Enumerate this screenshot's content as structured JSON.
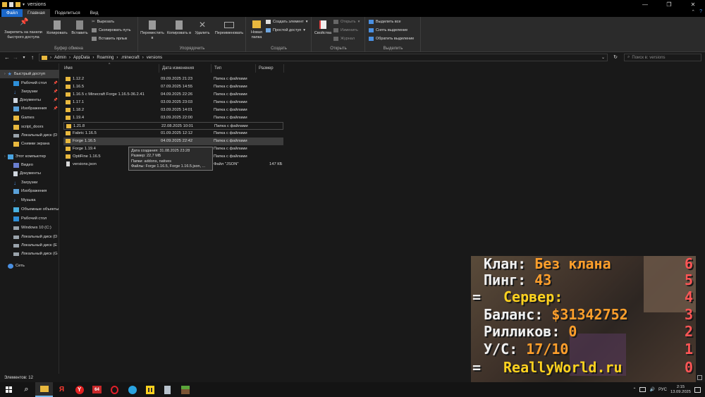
{
  "window": {
    "title": "versions"
  },
  "tabs": {
    "file": "Файл",
    "home": "Главная",
    "share": "Поделиться",
    "view": "Вид"
  },
  "ribbon": {
    "pin_label": "Закрепить на панели быстрого доступа",
    "copy_label": "Копировать",
    "paste_label": "Вставить",
    "cut_label": "Вырезать",
    "copy_path_label": "Скопировать путь",
    "paste_shortcut_label": "Вставить ярлык",
    "clipboard_group": "Буфер обмена",
    "move_label": "Переместить в",
    "copy_to_label": "Копировать в",
    "delete_label": "Удалить",
    "rename_label": "Переименовать",
    "organize_group": "Упорядочить",
    "new_folder_label": "Новая папка",
    "new_item_label": "Создать элемент",
    "easy_access_label": "Простой доступ",
    "new_group": "Создать",
    "properties_label": "Свойства",
    "open_label": "Открыть",
    "edit_label": "Изменить",
    "history_label": "Журнал",
    "open_group": "Открыть",
    "select_all_label": "Выделить все",
    "select_none_label": "Снять выделение",
    "invert_selection_label": "Обратить выделение",
    "select_group": "Выделить"
  },
  "address": {
    "path": [
      "Admin",
      "AppData",
      "Roaming",
      ".minecraft",
      "versions"
    ],
    "search_placeholder": "Поиск в: versions"
  },
  "nav": {
    "items": [
      {
        "label": "Быстрый доступ",
        "icon": "star-icon",
        "pinned": false
      },
      {
        "label": "Рабочий стол",
        "icon": "desktop-icon",
        "pinned": true
      },
      {
        "label": "Загрузки",
        "icon": "download-icon",
        "pinned": true
      },
      {
        "label": "Документы",
        "icon": "documents-icon",
        "pinned": true
      },
      {
        "label": "Изображения",
        "icon": "pictures-icon",
        "pinned": true
      },
      {
        "label": "Games",
        "icon": "folder-icon",
        "pinned": false
      },
      {
        "label": "script_doors",
        "icon": "folder-icon",
        "pinned": false
      },
      {
        "label": "Локальный диск (D",
        "icon": "drive-icon",
        "pinned": false
      },
      {
        "label": "Снимки экрана",
        "icon": "folder-icon",
        "pinned": false
      },
      {
        "label": "Этот компьютер",
        "icon": "computer-icon",
        "pinned": false
      },
      {
        "label": "Видео",
        "icon": "video-icon",
        "pinned": false
      },
      {
        "label": "Документы",
        "icon": "documents-icon",
        "pinned": false
      },
      {
        "label": "Загрузки",
        "icon": "download-icon",
        "pinned": false
      },
      {
        "label": "Изображения",
        "icon": "pictures-icon",
        "pinned": false
      },
      {
        "label": "Музыка",
        "icon": "music-icon",
        "pinned": false
      },
      {
        "label": "Объемные объекты",
        "icon": "3d-objects-icon",
        "pinned": false
      },
      {
        "label": "Рабочий стол",
        "icon": "desktop-icon",
        "pinned": false
      },
      {
        "label": "Windows 10 (C:)",
        "icon": "drive-icon",
        "pinned": false
      },
      {
        "label": "Локальный диск (D",
        "icon": "drive-icon",
        "pinned": false
      },
      {
        "label": "Локальный диск (E",
        "icon": "drive-icon",
        "pinned": false
      },
      {
        "label": "Локальный диск (G",
        "icon": "drive-icon",
        "pinned": false
      },
      {
        "label": "Сеть",
        "icon": "network-icon",
        "pinned": false
      }
    ]
  },
  "columns": {
    "name": "Имя",
    "date": "Дата изменения",
    "type": "Тип",
    "size": "Размер"
  },
  "files": [
    {
      "name": "1.12.2",
      "date": "09.09.2025 21:23",
      "type": "Папка с файлами",
      "size": "",
      "kind": "folder"
    },
    {
      "name": "1.16.5",
      "date": "07.09.2025 14:55",
      "type": "Папка с файлами",
      "size": "",
      "kind": "folder"
    },
    {
      "name": "1.16.5 с Minecraft Forge 1.16.5-36.2.41",
      "date": "04.09.2025 22:26",
      "type": "Папка с файлами",
      "size": "",
      "kind": "folder"
    },
    {
      "name": "1.17.1",
      "date": "03.09.2025 23:03",
      "type": "Папка с файлами",
      "size": "",
      "kind": "folder"
    },
    {
      "name": "1.18.2",
      "date": "03.09.2025 14:01",
      "type": "Папка с файлами",
      "size": "",
      "kind": "folder"
    },
    {
      "name": "1.19.4",
      "date": "03.09.2025 22:00",
      "type": "Папка с файлами",
      "size": "",
      "kind": "folder"
    },
    {
      "name": "1.21.8",
      "date": "22.08.2025 10:01",
      "type": "Папка с файлами",
      "size": "",
      "kind": "folder"
    },
    {
      "name": "Fabric 1.16.5",
      "date": "01.09.2025 12:12",
      "type": "Папка с файлами",
      "size": "",
      "kind": "folder"
    },
    {
      "name": "Forge 1.16.5",
      "date": "04.09.2025 22:42",
      "type": "Папка с файлами",
      "size": "",
      "kind": "folder"
    },
    {
      "name": "Forge 1.19.4",
      "date": "",
      "type": "Папка с файлами",
      "size": "",
      "kind": "folder"
    },
    {
      "name": "OptiFine 1.16.5",
      "date": "",
      "type": "Папка с файлами",
      "size": "",
      "kind": "folder"
    },
    {
      "name": "versions.json",
      "date": "",
      "type": "Файл \"JSON\"",
      "size": "147 КБ",
      "kind": "file"
    }
  ],
  "tooltip": {
    "line1": "Дата создания: 31.08.2025 23:28",
    "line2": "Размер: 22,7 МБ",
    "line3": "Папки: addons, natives",
    "line4": "Файлы: Forge 1.16.5, Forge 1.16.5.json, ..."
  },
  "status": {
    "items_count": "Элементов: 12"
  },
  "scoreboard": {
    "clan_label": "Клан: ",
    "clan_value": "Без клана",
    "clan_num": "6",
    "ping_label": "Пинг: ",
    "ping_value": "43",
    "ping_num": "5",
    "server_bar": "=",
    "server_label": "Сервер:",
    "server_num": "4",
    "balance_label": "Баланс: ",
    "balance_value": "$31342752",
    "balance_num": "3",
    "rillik_label": "Рилликов: ",
    "rillik_value": "0",
    "rillik_num": "2",
    "ys_label": "У/С: ",
    "ys_value": "17/10",
    "ys_num": "1",
    "site_bar": "=",
    "site": "ReallyWorld.ru",
    "site_num": "0"
  },
  "tray": {
    "lang": "РУС",
    "time": "2:15",
    "date": "13.09.2025"
  },
  "colors": {
    "accent": "#1a67c9",
    "folder": "#e8b83e",
    "score_red": "#ff5555",
    "score_orange": "#ff9f2b",
    "score_gold": "#ffd21f"
  }
}
